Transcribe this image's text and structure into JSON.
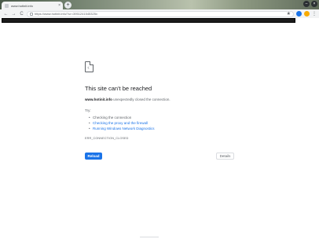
{
  "tab": {
    "title": "www.hotinit.info",
    "close": "×",
    "new_tab": "+"
  },
  "toolbar": {
    "back": "←",
    "forward": "→",
    "reload": "C",
    "url": "https://www.hotinit.info/?ur=3951241545325x",
    "star": "★",
    "menu": "⋮"
  },
  "error": {
    "title": "This site can't be reached",
    "host": "www.hotinit.info",
    "description_rest": " unexpectedly closed the connection.",
    "try_label": "Try:",
    "suggestions": [
      "Checking the connection",
      "Checking the proxy and the firewall",
      "Running Windows Network Diagnostics"
    ],
    "code": "ERR_CONNECTION_CLOSED",
    "reload_label": "Reload",
    "details_label": "Details"
  },
  "colors": {
    "accent": "#1a73e8",
    "text": "#202124",
    "muted": "#5f6368"
  }
}
